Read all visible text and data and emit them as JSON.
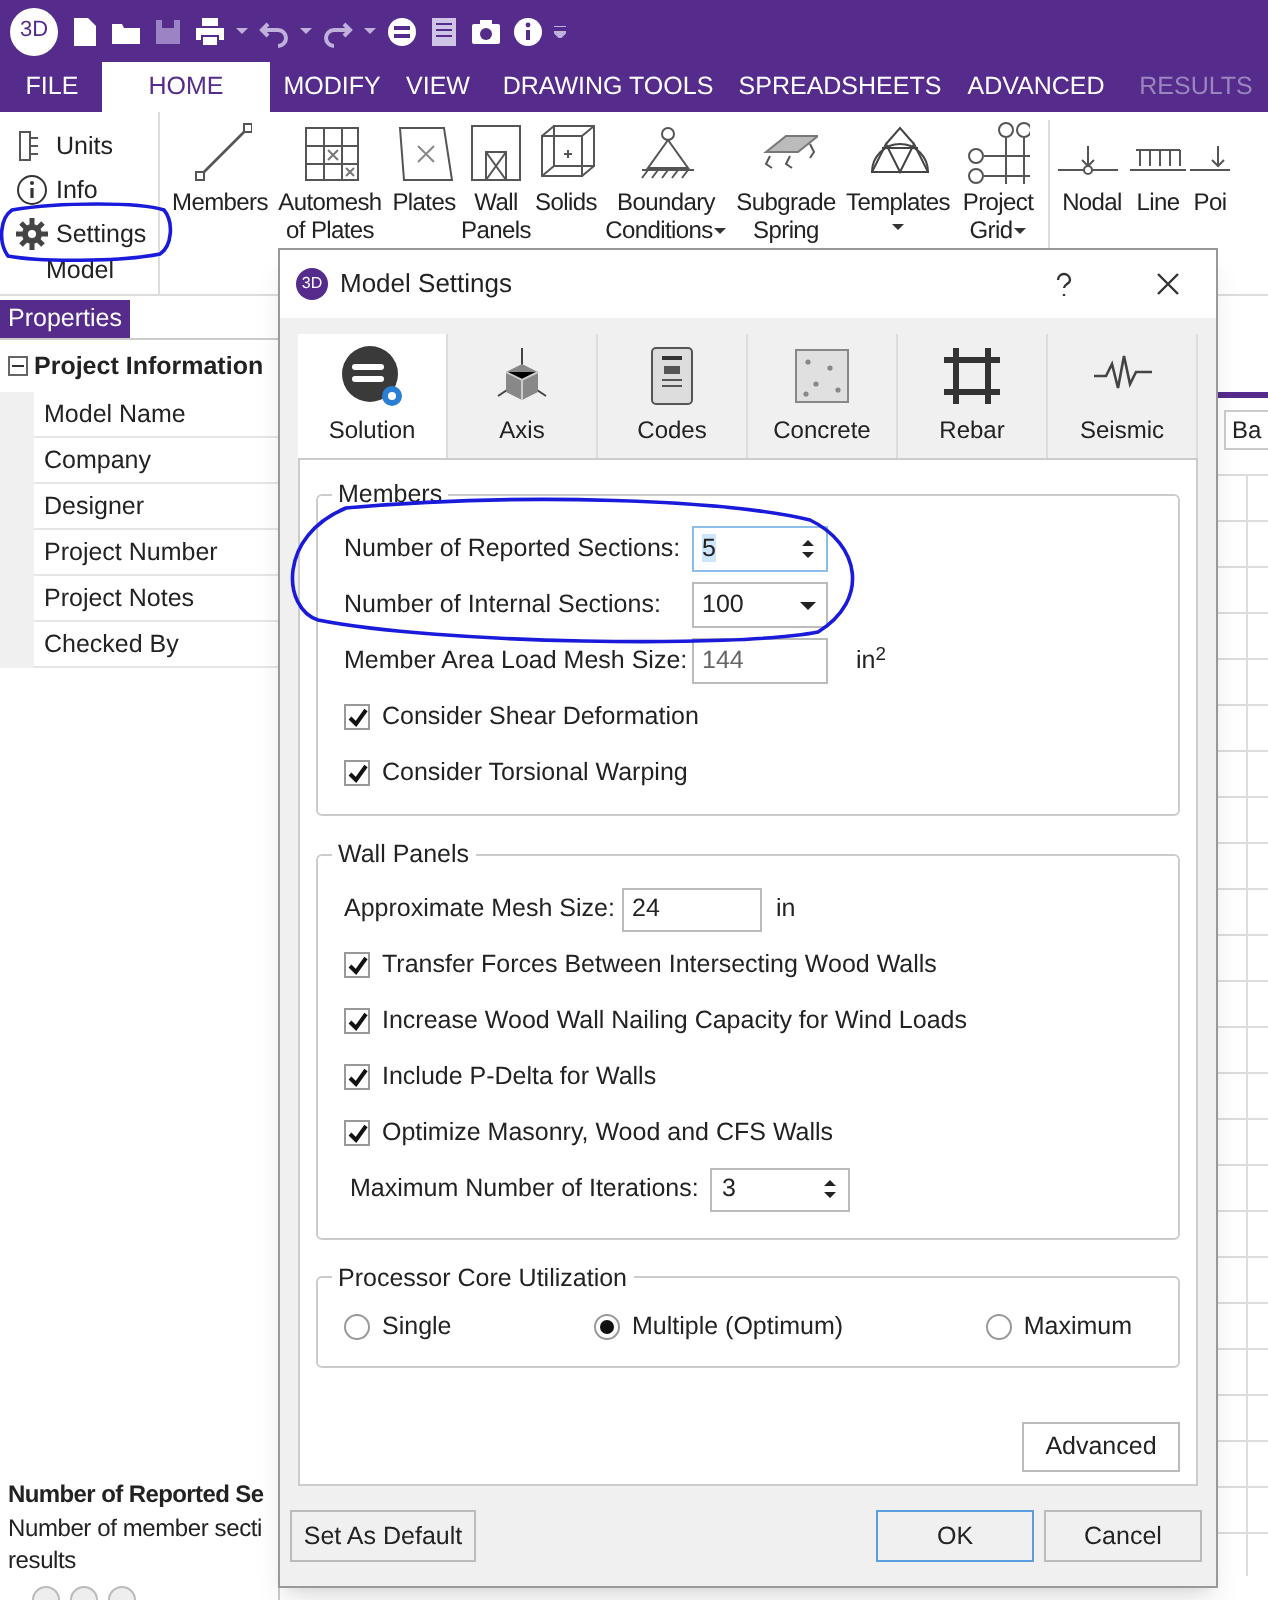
{
  "app": {
    "logo": "3D",
    "menu_tabs": [
      {
        "label": "FILE",
        "selected": false,
        "disabled": false
      },
      {
        "label": "HOME",
        "selected": true,
        "disabled": false
      },
      {
        "label": "MODIFY",
        "selected": false,
        "disabled": false
      },
      {
        "label": "VIEW",
        "selected": false,
        "disabled": false
      },
      {
        "label": "DRAWING TOOLS",
        "selected": false,
        "disabled": false
      },
      {
        "label": "SPREADSHEETS",
        "selected": false,
        "disabled": false
      },
      {
        "label": "ADVANCED",
        "selected": false,
        "disabled": false
      },
      {
        "label": "RESULTS",
        "selected": false,
        "disabled": true
      }
    ]
  },
  "ribbon": {
    "model_items": [
      "Units",
      "Info",
      "Settings"
    ],
    "model_group_label": "Model",
    "buttons": [
      {
        "lines": [
          "Members"
        ],
        "dropdown": false
      },
      {
        "lines": [
          "Automesh",
          "of Plates"
        ],
        "dropdown": false
      },
      {
        "lines": [
          "Plates"
        ],
        "dropdown": false
      },
      {
        "lines": [
          "Wall",
          "Panels"
        ],
        "dropdown": false
      },
      {
        "lines": [
          "Solids"
        ],
        "dropdown": false
      },
      {
        "lines": [
          "Boundary",
          "Conditions"
        ],
        "dropdown": true
      },
      {
        "lines": [
          "Subgrade",
          "Spring"
        ],
        "dropdown": false
      },
      {
        "lines": [
          "Templates"
        ],
        "dropdown": true
      },
      {
        "lines": [
          "Project",
          "Grid"
        ],
        "dropdown": true
      },
      {
        "lines": [
          "Nodal"
        ],
        "dropdown": false
      },
      {
        "lines": [
          "Line"
        ],
        "dropdown": false
      },
      {
        "lines": [
          "Poi"
        ],
        "dropdown": false
      }
    ]
  },
  "properties": {
    "tab": "Properties",
    "section": "Project Information",
    "expanded": true,
    "rows": [
      "Model Name",
      "Company",
      "Designer",
      "Project Number",
      "Project Notes",
      "Checked By"
    ],
    "help_title": "Number of Reported Se",
    "help_lines": [
      "Number of member secti",
      "results"
    ]
  },
  "canvas": {
    "field_text": "Ba"
  },
  "dialog": {
    "title": "Model Settings",
    "logo": "3D",
    "tabs": [
      {
        "label": "Solution",
        "selected": true
      },
      {
        "label": "Axis",
        "selected": false
      },
      {
        "label": "Codes",
        "selected": false
      },
      {
        "label": "Concrete",
        "selected": false
      },
      {
        "label": "Rebar",
        "selected": false
      },
      {
        "label": "Seismic",
        "selected": false
      }
    ],
    "members": {
      "title": "Members",
      "fields": [
        {
          "label": "Number of Reported Sections:",
          "kind": "spin",
          "value": "5",
          "text_selected": true
        },
        {
          "label": "Number of Internal Sections:",
          "kind": "dropdown",
          "value": "100",
          "text_selected": false
        },
        {
          "label": "Member Area Load Mesh Size:",
          "kind": "text",
          "value": "144",
          "unit": "in$^{2}$",
          "text_selected": false
        }
      ],
      "checkboxes": [
        {
          "label": "Consider Shear Deformation",
          "checked": true
        },
        {
          "label": "Consider Torsional Warping",
          "checked": true
        }
      ]
    },
    "wall_panels": {
      "title": "Wall Panels",
      "mesh_label": "Approximate Mesh Size:",
      "mesh_value": "24",
      "mesh_unit": "in",
      "checkboxes": [
        {
          "label": "Transfer Forces Between Intersecting Wood Walls",
          "checked": true
        },
        {
          "label": "Increase Wood Wall Nailing Capacity for Wind Loads",
          "checked": true
        },
        {
          "label": "Include P-Delta for Walls",
          "checked": true
        },
        {
          "label": "Optimize Masonry, Wood and CFS Walls",
          "checked": true
        }
      ],
      "iterations_label": "Maximum Number of Iterations:",
      "iterations_value": "3"
    },
    "processor": {
      "title": "Processor Core Utilization",
      "options": [
        {
          "label": "Single",
          "selected": false
        },
        {
          "label": "Multiple (Optimum)",
          "selected": true
        },
        {
          "label": "Maximum",
          "selected": false
        }
      ]
    },
    "advanced_button": "Advanced",
    "default_button": "Set As Default",
    "ok_button": "OK",
    "cancel_button": "Cancel"
  }
}
